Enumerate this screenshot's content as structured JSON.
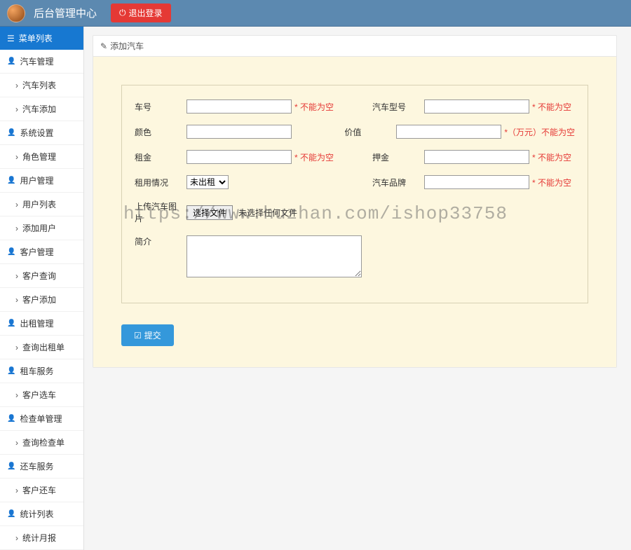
{
  "header": {
    "title": "后台管理中心",
    "logout": "退出登录"
  },
  "sidebar": {
    "menu_header": "菜单列表",
    "groups": [
      {
        "label": "汽车管理",
        "items": [
          "汽车列表",
          "汽车添加"
        ]
      },
      {
        "label": "系统设置",
        "items": [
          "角色管理"
        ]
      },
      {
        "label": "用户管理",
        "items": [
          "用户列表",
          "添加用户"
        ]
      },
      {
        "label": "客户管理",
        "items": [
          "客户查询",
          "客户添加"
        ]
      },
      {
        "label": "出租管理",
        "items": [
          "查询出租单"
        ]
      },
      {
        "label": "租车服务",
        "items": [
          "客户选车"
        ]
      },
      {
        "label": "检查单管理",
        "items": [
          "查询检查单"
        ]
      },
      {
        "label": "还车服务",
        "items": [
          "客户还车"
        ]
      },
      {
        "label": "统计列表",
        "items": [
          "统计月报"
        ]
      }
    ]
  },
  "panel": {
    "title": "添加汽车"
  },
  "form": {
    "car_number": {
      "label": "车号",
      "hint": "* 不能为空"
    },
    "car_model": {
      "label": "汽车型号",
      "hint": "* 不能为空"
    },
    "color": {
      "label": "颜色",
      "hint": ""
    },
    "price": {
      "label": "价值",
      "hint": "*（万元）不能为空"
    },
    "rent": {
      "label": "租金",
      "hint": "* 不能为空"
    },
    "deposit": {
      "label": "押金",
      "hint": "* 不能为空"
    },
    "rent_status": {
      "label": "租用情况",
      "selected": "未出租"
    },
    "brand": {
      "label": "汽车品牌",
      "hint": "* 不能为空"
    },
    "upload": {
      "label": "上传汽车图片",
      "button": "选择文件",
      "no_file": "未选择任何文件"
    },
    "intro": {
      "label": "简介"
    },
    "submit": "提交"
  },
  "watermark": "https://www.huzhan.com/ishop33758"
}
